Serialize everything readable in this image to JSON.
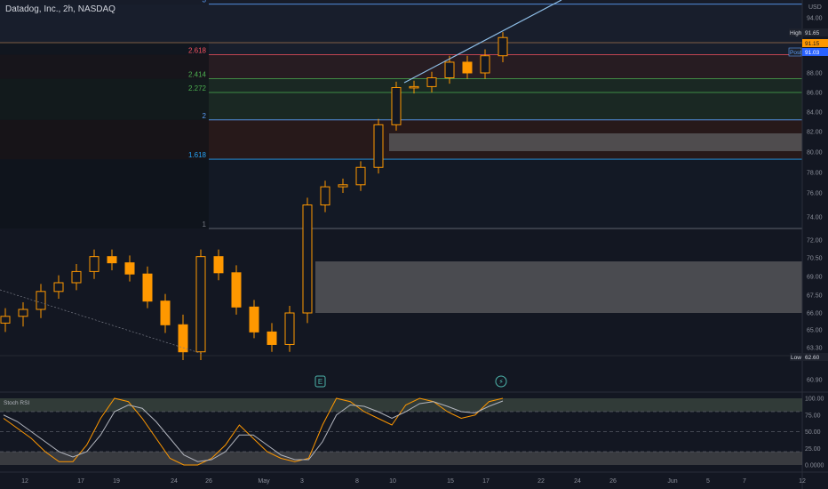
{
  "header": {
    "symbol_title": "Datadog, Inc., 2h, NASDAQ"
  },
  "price_axis": {
    "currency": "USD",
    "ticks": [
      "94.00",
      "91.65",
      "88.00",
      "86.00",
      "84.00",
      "82.00",
      "80.00",
      "78.00",
      "76.00",
      "74.00",
      "72.00",
      "70.50",
      "69.00",
      "67.50",
      "66.00",
      "65.00",
      "63.30",
      "62.60",
      "60.90"
    ],
    "tick_values": [
      94.0,
      91.65,
      88.0,
      86.0,
      84.0,
      82.0,
      80.0,
      78.0,
      76.0,
      74.0,
      72.0,
      70.5,
      69.0,
      67.5,
      66.0,
      65.0,
      63.3,
      62.6,
      60.9
    ],
    "high_label": "High",
    "high_value": "91.65",
    "last_price": "91.15",
    "post_label": "Post",
    "post_value": "91.03",
    "low_label": "Low",
    "low_value": "62.60"
  },
  "time_axis": {
    "labels": [
      "12",
      "17",
      "19",
      "24",
      "26",
      "May",
      "3",
      "8",
      "10",
      "15",
      "17",
      "22",
      "24",
      "26",
      "Jun",
      "5",
      "7",
      "12"
    ]
  },
  "fib_levels": [
    {
      "label": "3",
      "price": 96.0,
      "color": "#5b9cf6"
    },
    {
      "label": "2.618",
      "price": 89.7,
      "color": "#f7525f"
    },
    {
      "label": "2.414",
      "price": 87.4,
      "color": "#4caf50"
    },
    {
      "label": "2.272",
      "price": 86.0,
      "color": "#4caf50"
    },
    {
      "label": "2",
      "price": 83.2,
      "color": "#5b9cf6"
    },
    {
      "label": "1.618",
      "price": 79.3,
      "color": "#26a1f3"
    },
    {
      "label": "1",
      "price": 73.0,
      "color": "#787b86"
    }
  ],
  "event_markers": [
    {
      "name": "earnings-icon",
      "glyph": "E"
    },
    {
      "name": "dividend-lightning-icon",
      "glyph": "⚡"
    }
  ],
  "indicator": {
    "title": "Stoch RSI",
    "ticks": [
      "100.00",
      "75.00",
      "50.00",
      "25.00",
      "0.0000"
    ],
    "tick_values": [
      100,
      75,
      50,
      25,
      0
    ]
  },
  "colors": {
    "background": "#131722",
    "candle": "#ff9800",
    "trendline": "#8fbfe8",
    "zone": "#5d5d60",
    "price_tag_orange": "#ff9800",
    "price_tag_blue": "#2962ff"
  },
  "chart_data": {
    "type": "candlestick",
    "title": "Datadog, Inc., 2h, NASDAQ",
    "x": [
      "12",
      "17",
      "19",
      "24",
      "26",
      "May",
      "3",
      "8",
      "10",
      "15",
      "17"
    ],
    "ylim": [
      60.9,
      94.0
    ],
    "close_series_approx": [
      65.8,
      66.3,
      67.8,
      68.5,
      69.4,
      70.6,
      70.1,
      69.2,
      67.0,
      65.3,
      63.0,
      70.6,
      69.3,
      66.5,
      64.8,
      63.6,
      66.0,
      75.0,
      76.6,
      76.8,
      78.5,
      82.7,
      86.5,
      86.6,
      87.5,
      89.0,
      88.0,
      89.6,
      91.3
    ],
    "high": 91.65,
    "low": 62.6,
    "last": 91.15
  }
}
